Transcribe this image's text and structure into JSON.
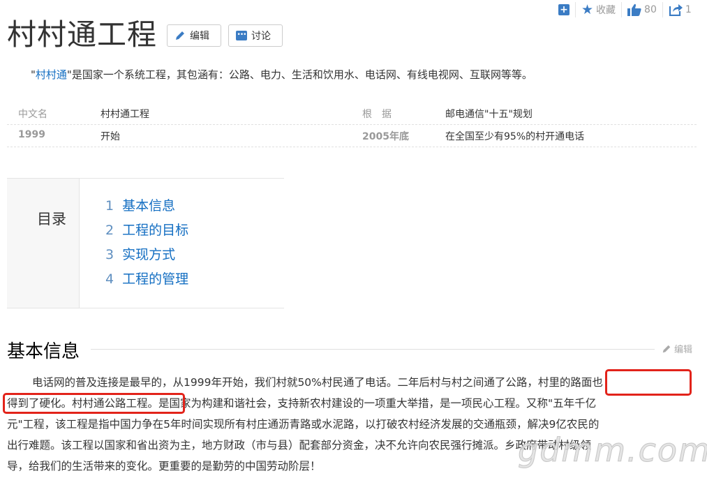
{
  "topbar": {
    "add_icon": "plus-square-icon",
    "favorite_label": "收藏",
    "like_count": "80",
    "share_count": "1"
  },
  "title": "村村通工程",
  "buttons": {
    "edit": "编辑",
    "discuss": "讨论"
  },
  "summary": {
    "link": "村村通",
    "text_before": "\"",
    "text_after": "\"是国家一个系统工程，其包涵有：公路、电力、生活和饮用水、电话网、有线电视网、互联网等等。"
  },
  "info": {
    "row1": {
      "k1": "中文名",
      "v1": "村村通工程",
      "k2": "根　据",
      "v2": "邮电通信\"十五\"规划"
    },
    "row2": {
      "k1": "1999",
      "v1": "开始",
      "k2": "2005年底",
      "v2": "在全国至少有95%的村开通电话"
    }
  },
  "catalog": {
    "title": "目录",
    "items": [
      {
        "num": "1",
        "label": "基本信息"
      },
      {
        "num": "2",
        "label": "工程的目标"
      },
      {
        "num": "3",
        "label": "实现方式"
      },
      {
        "num": "4",
        "label": "工程的管理"
      }
    ]
  },
  "section": {
    "title": "基本信息",
    "edit": "编辑"
  },
  "paragraph": {
    "line1": "电话网的普及连接是最早的，从1999年开始，我们村就50%村民通了电话。二年后村与村之间通了公路，村里的路面也",
    "line2": "得到了硬化。村村通公路工程。是国家为构建和谐社会，支持新农村建设的一项重大举措，是一项民心工程。又称\"五年千亿",
    "line3": "元\"工程，该工程是指中国力争在5年时间实现所有村庄通沥青路或水泥路，以打破农村经济发展的交通瓶颈，解决9亿农民的",
    "line4": "出行难题。该工程以国家和省出资为主，地方财政（市与县）配套部分资金，决不允许向农民强行摊派。乡政府带动村级领",
    "line5": "导，给我们的生活带来的变化。更重要的是勤劳的中国劳动阶层！"
  },
  "watermark": "gdmm.com"
}
